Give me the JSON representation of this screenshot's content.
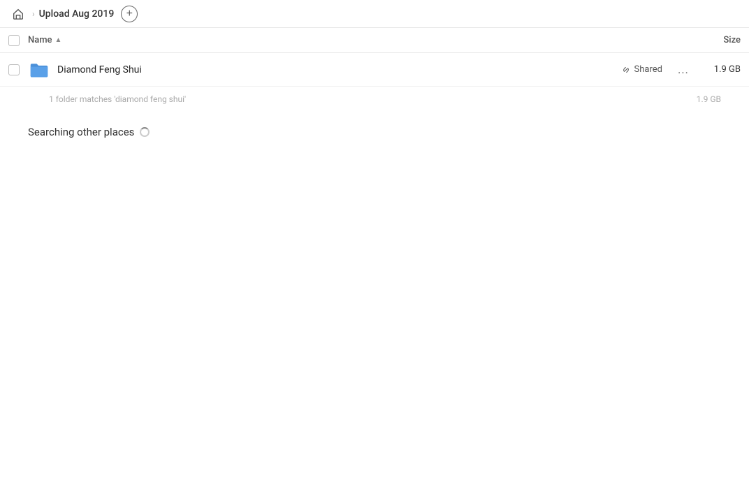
{
  "header": {
    "home_label": "home",
    "breadcrumb_title": "Upload Aug 2019",
    "add_button_label": "+"
  },
  "columns": {
    "name_label": "Name",
    "size_label": "Size"
  },
  "file_row": {
    "icon_color": "#4a90d9",
    "name": "Diamond Feng Shui",
    "shared_label": "Shared",
    "more_label": "...",
    "size": "1.9 GB"
  },
  "sub_info": {
    "text": "1 folder matches 'diamond feng shui'",
    "size": "1.9 GB"
  },
  "searching": {
    "text": "Searching other places"
  }
}
